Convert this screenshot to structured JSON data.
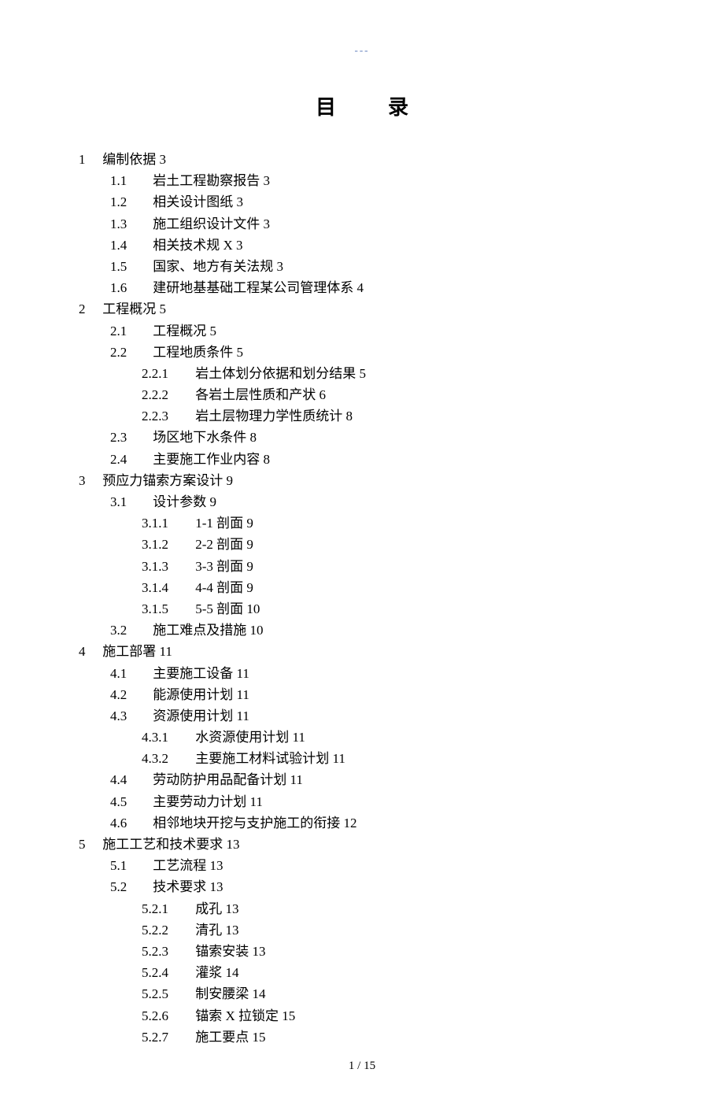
{
  "header_mark": "---",
  "title": "目　录",
  "toc": [
    {
      "lvl": 1,
      "num": "1",
      "text": "编制依据",
      "page": "3"
    },
    {
      "lvl": 2,
      "num": "1.1",
      "text": "岩土工程勘察报告",
      "page": "3"
    },
    {
      "lvl": 2,
      "num": "1.2",
      "text": "相关设计图纸",
      "page": "3"
    },
    {
      "lvl": 2,
      "num": "1.3",
      "text": "施工组织设计文件",
      "page": "3"
    },
    {
      "lvl": 2,
      "num": "1.4",
      "text": "相关技术规 X",
      "page": "3"
    },
    {
      "lvl": 2,
      "num": "1.5",
      "text": "国家、地方有关法规",
      "page": "3"
    },
    {
      "lvl": 2,
      "num": "1.6",
      "text": "建研地基基础工程某公司管理体系",
      "page": "4"
    },
    {
      "lvl": 1,
      "num": "2",
      "text": "工程概况",
      "page": "5"
    },
    {
      "lvl": 2,
      "num": "2.1",
      "text": "工程概况",
      "page": "5"
    },
    {
      "lvl": 2,
      "num": "2.2",
      "text": "工程地质条件",
      "page": "5"
    },
    {
      "lvl": 3,
      "num": "2.2.1",
      "text": "岩土体划分依据和划分结果",
      "page": "5"
    },
    {
      "lvl": 3,
      "num": "2.2.2",
      "text": "各岩土层性质和产状",
      "page": "6"
    },
    {
      "lvl": 3,
      "num": "2.2.3",
      "text": "岩土层物理力学性质统计",
      "page": "8"
    },
    {
      "lvl": 2,
      "num": "2.3",
      "text": "场区地下水条件",
      "page": "8"
    },
    {
      "lvl": 2,
      "num": "2.4",
      "text": "主要施工作业内容",
      "page": "8"
    },
    {
      "lvl": 1,
      "num": "3",
      "text": "预应力锚索方案设计",
      "page": "9"
    },
    {
      "lvl": 2,
      "num": "3.1",
      "text": "设计参数",
      "page": "9"
    },
    {
      "lvl": 3,
      "num": "3.1.1",
      "text": "1-1 剖面",
      "page": "9"
    },
    {
      "lvl": 3,
      "num": "3.1.2",
      "text": "2-2 剖面",
      "page": "9"
    },
    {
      "lvl": 3,
      "num": "3.1.3",
      "text": "3-3 剖面",
      "page": "9"
    },
    {
      "lvl": 3,
      "num": "3.1.4",
      "text": "4-4 剖面",
      "page": "9"
    },
    {
      "lvl": 3,
      "num": "3.1.5",
      "text": "5-5 剖面",
      "page": "10"
    },
    {
      "lvl": 2,
      "num": "3.2",
      "text": "施工难点及措施",
      "page": "10"
    },
    {
      "lvl": 1,
      "num": "4",
      "text": "施工部署",
      "page": "11"
    },
    {
      "lvl": 2,
      "num": "4.1",
      "text": "主要施工设备",
      "page": "11"
    },
    {
      "lvl": 2,
      "num": "4.2",
      "text": "能源使用计划",
      "page": "11"
    },
    {
      "lvl": 2,
      "num": "4.3",
      "text": "资源使用计划",
      "page": "11"
    },
    {
      "lvl": 3,
      "num": "4.3.1",
      "text": "水资源使用计划",
      "page": "11"
    },
    {
      "lvl": 3,
      "num": "4.3.2",
      "text": "主要施工材料试验计划",
      "page": "11"
    },
    {
      "lvl": 2,
      "num": "4.4",
      "text": "劳动防护用品配备计划",
      "page": "11"
    },
    {
      "lvl": 2,
      "num": "4.5",
      "text": "主要劳动力计划",
      "page": "11"
    },
    {
      "lvl": 2,
      "num": "4.6",
      "text": "相邻地块开挖与支护施工的衔接",
      "page": "12"
    },
    {
      "lvl": 1,
      "num": "5",
      "text": "施工工艺和技术要求",
      "page": "13"
    },
    {
      "lvl": 2,
      "num": "5.1",
      "text": "工艺流程",
      "page": "13"
    },
    {
      "lvl": 2,
      "num": "5.2",
      "text": "技术要求",
      "page": "13"
    },
    {
      "lvl": 3,
      "num": "5.2.1",
      "text": "成孔",
      "page": "13"
    },
    {
      "lvl": 3,
      "num": "5.2.2",
      "text": "清孔",
      "page": "13"
    },
    {
      "lvl": 3,
      "num": "5.2.3",
      "text": "锚索安装",
      "page": "13"
    },
    {
      "lvl": 3,
      "num": "5.2.4",
      "text": "灌浆",
      "page": "14"
    },
    {
      "lvl": 3,
      "num": "5.2.5",
      "text": "制安腰梁",
      "page": "14"
    },
    {
      "lvl": 3,
      "num": "5.2.6",
      "text": "锚索 X 拉锁定",
      "page": "15"
    },
    {
      "lvl": 3,
      "num": "5.2.7",
      "text": "施工要点",
      "page": "15"
    }
  ],
  "footer": "1 / 15"
}
